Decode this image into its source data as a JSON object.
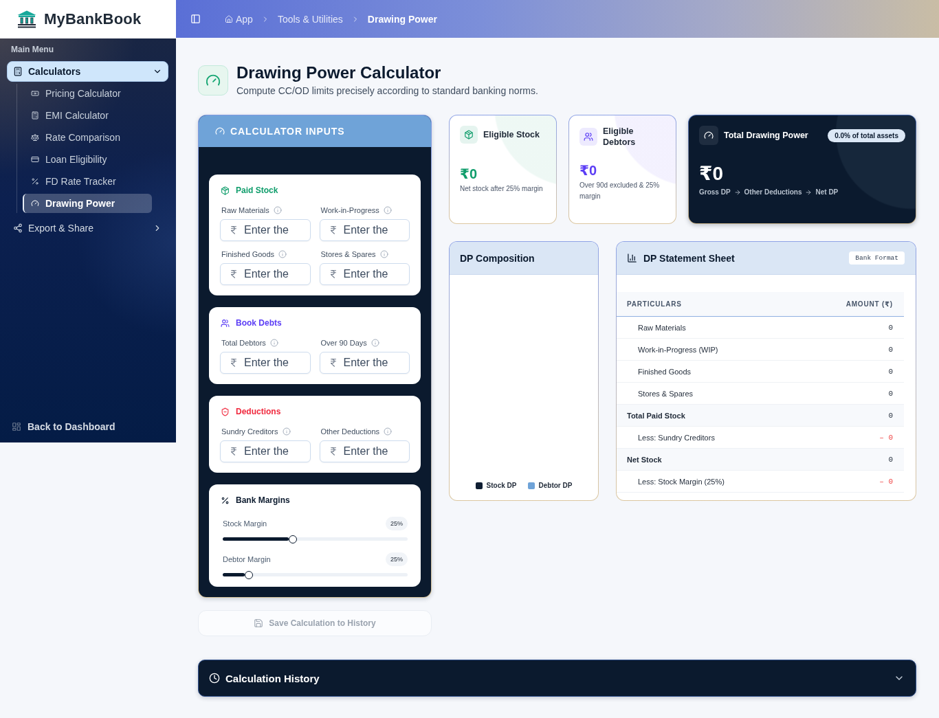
{
  "sidebar": {
    "brand": "MyBankBook",
    "section_label": "Main Menu",
    "items": [
      {
        "label": "Calculators",
        "expanded": true,
        "children": [
          {
            "label": "Pricing Calculator",
            "selected": false
          },
          {
            "label": "EMI Calculator",
            "selected": false
          },
          {
            "label": "Rate Comparison",
            "selected": false
          },
          {
            "label": "Loan Eligibility",
            "selected": false
          },
          {
            "label": "FD Rate Tracker",
            "selected": false
          },
          {
            "label": "Drawing Power",
            "selected": true
          }
        ]
      },
      {
        "label": "Export & Share",
        "expanded": false
      }
    ],
    "footer_link": "Back to Dashboard"
  },
  "topbar": {
    "breadcrumbs": [
      {
        "label": "App",
        "current": false
      },
      {
        "label": "Tools & Utilities",
        "current": false
      },
      {
        "label": "Drawing Power",
        "current": true
      }
    ]
  },
  "header": {
    "title": "Drawing Power Calculator",
    "subtitle": "Compute CC/OD limits precisely according to standard banking norms."
  },
  "inputs_panel": {
    "title": "CALCULATOR INPUTS",
    "sections": [
      {
        "kind": "fields",
        "title": "Paid Stock",
        "color": "#0f9d6b",
        "fields": [
          {
            "label": "Raw Materials",
            "placeholder": "Enter the"
          },
          {
            "label": "Work-in-Progress",
            "placeholder": "Enter the"
          },
          {
            "label": "Finished Goods",
            "placeholder": "Enter the"
          },
          {
            "label": "Stores & Spares",
            "placeholder": "Enter the"
          }
        ]
      },
      {
        "kind": "fields",
        "title": "Book Debts",
        "color": "#5b3df5",
        "fields": [
          {
            "label": "Total Debtors",
            "placeholder": "Enter the"
          },
          {
            "label": "Over 90 Days",
            "placeholder": "Enter the"
          }
        ]
      },
      {
        "kind": "fields",
        "title": "Deductions",
        "color": "#f0293e",
        "fields": [
          {
            "label": "Sundry Creditors",
            "placeholder": "Enter the"
          },
          {
            "label": "Other Deductions",
            "placeholder": "Enter the"
          }
        ]
      },
      {
        "kind": "sliders",
        "title": "Bank Margins",
        "color": "#0b1a2e",
        "sliders": [
          {
            "label": "Stock Margin",
            "reading": "25%",
            "level": 0.38
          },
          {
            "label": "Debtor Margin",
            "reading": "25%",
            "level": 0.14
          }
        ]
      }
    ]
  },
  "save_button": {
    "label": "Save Calculation to History",
    "disabled": true
  },
  "summary_cards": [
    {
      "kind": "stat",
      "title": "Eligible Stock",
      "value": "₹0",
      "note": "Net stock after 25% margin",
      "color": "#0f9d6b"
    },
    {
      "kind": "stat",
      "title": "Eligible Debtors",
      "value": "₹0",
      "note": "Over 90d excluded & 25% margin",
      "color": "#5b3df5"
    },
    {
      "kind": "total",
      "title": "Total Drawing Power",
      "badge": "0.0% of total assets",
      "value": "₹0",
      "flow": [
        "Gross DP",
        "Other Deductions",
        "Net DP"
      ]
    }
  ],
  "composition": {
    "title": "DP Composition",
    "legend": [
      {
        "label": "Stock DP",
        "color": "#0f1e33"
      },
      {
        "label": "Debtor DP",
        "color": "#6fa3d8"
      }
    ]
  },
  "statement": {
    "title": "DP Statement Sheet",
    "badge": "Bank Format",
    "columns": [
      "PARTICULARS",
      "AMOUNT (₹)"
    ],
    "rows": [
      {
        "kind": "item",
        "label": "Raw Materials",
        "amount": "0"
      },
      {
        "kind": "item",
        "label": "Work-in-Progress (WIP)",
        "amount": "0"
      },
      {
        "kind": "item",
        "label": "Finished Goods",
        "amount": "0"
      },
      {
        "kind": "item",
        "label": "Stores & Spares",
        "amount": "0"
      },
      {
        "kind": "total",
        "label": "Total Paid Stock",
        "amount": "0"
      },
      {
        "kind": "less",
        "label": "Less: Sundry Creditors",
        "amount": "– 0"
      },
      {
        "kind": "total",
        "label": "Net Stock",
        "amount": "0"
      },
      {
        "kind": "less",
        "label": "Less: Stock Margin (25%)",
        "amount": "– 0"
      }
    ]
  },
  "history": {
    "title": "Calculation History",
    "expanded": false
  }
}
